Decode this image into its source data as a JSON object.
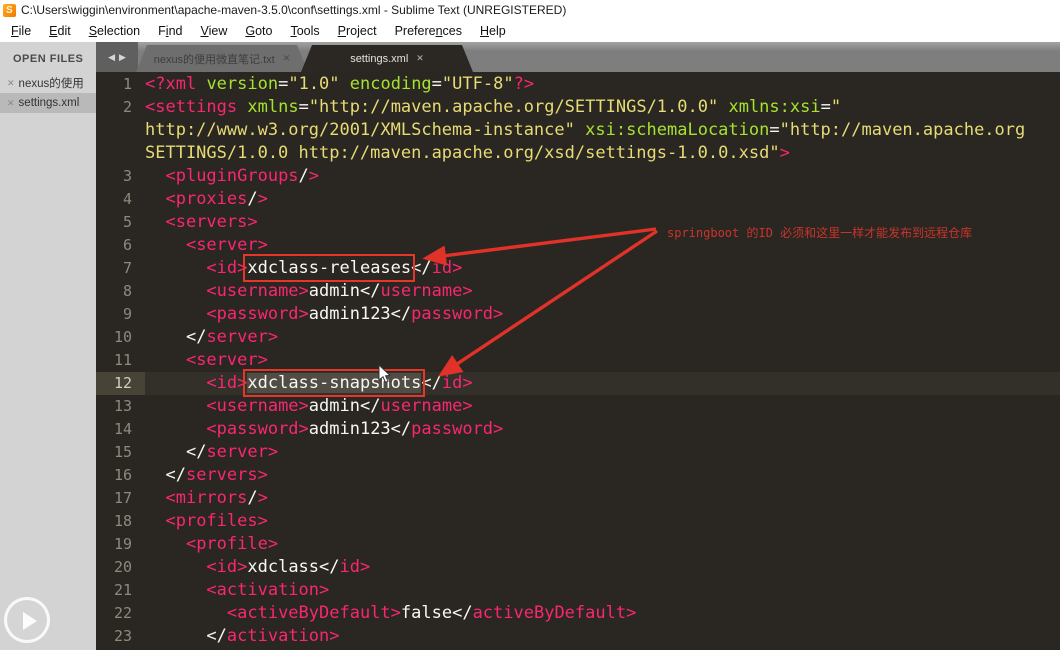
{
  "window": {
    "title": "C:\\Users\\wiggin\\environment\\apache-maven-3.5.0\\conf\\settings.xml - Sublime Text (UNREGISTERED)"
  },
  "menu": {
    "items": [
      {
        "label": "File",
        "u": 0
      },
      {
        "label": "Edit",
        "u": 0
      },
      {
        "label": "Selection",
        "u": 0
      },
      {
        "label": "Find",
        "u": 1
      },
      {
        "label": "View",
        "u": 0
      },
      {
        "label": "Goto",
        "u": 0
      },
      {
        "label": "Tools",
        "u": 0
      },
      {
        "label": "Project",
        "u": 0
      },
      {
        "label": "Preferences",
        "u": 7
      },
      {
        "label": "Help",
        "u": 0
      }
    ]
  },
  "sidebar": {
    "header": "OPEN FILES",
    "files": [
      {
        "label": "nexus的使用",
        "close": "✕",
        "selected": false
      },
      {
        "label": "settings.xml",
        "close": "✕",
        "selected": true
      }
    ]
  },
  "tabbar": {
    "prev_icon": "◀",
    "next_icon": "▶",
    "tabs": [
      {
        "label": "nexus的便用微直笔记.txt",
        "close": "✕",
        "active": false
      },
      {
        "label": "settings.xml",
        "close": "✕",
        "active": true
      }
    ]
  },
  "annotation": {
    "note": "springboot 的ID 必须和这里一样才能发布到远程仓库",
    "boxed_values": [
      "xdclass-releases",
      "xdclass-snapshots"
    ]
  },
  "colors": {
    "annotation_red": "#e8352a",
    "tag_pink": "#f92672",
    "attr_green": "#a6e22e",
    "string_yellow": "#e6db74",
    "editor_bg": "#2a2722",
    "sidebar_bg": "#d3d3d3"
  },
  "editor": {
    "current_line": "12",
    "rows": [
      {
        "n": "1",
        "toks": [
          [
            "t",
            "<?xml"
          ],
          [
            "x",
            " "
          ],
          [
            "a",
            "version"
          ],
          [
            "p",
            "="
          ],
          [
            "s",
            "\"1.0\""
          ],
          [
            "x",
            " "
          ],
          [
            "a",
            "encoding"
          ],
          [
            "p",
            "="
          ],
          [
            "s",
            "\"UTF-8\""
          ],
          [
            "t",
            "?>"
          ]
        ]
      },
      {
        "n": "2",
        "toks": [
          [
            "t",
            "<settings"
          ],
          [
            "x",
            " "
          ],
          [
            "a",
            "xmlns"
          ],
          [
            "p",
            "="
          ],
          [
            "s",
            "\"http://maven.apache.org/SETTINGS/1.0.0\""
          ],
          [
            "x",
            " "
          ],
          [
            "a",
            "xmlns:xsi"
          ],
          [
            "p",
            "="
          ],
          [
            "s",
            "\""
          ]
        ]
      },
      {
        "n": "",
        "toks": [
          [
            "s",
            "http://www.w3.org/2001/XMLSchema-instance\""
          ],
          [
            "x",
            " "
          ],
          [
            "a",
            "xsi:schemaLocation"
          ],
          [
            "p",
            "="
          ],
          [
            "s",
            "\"http://maven.apache.org"
          ]
        ]
      },
      {
        "n": "",
        "toks": [
          [
            "s",
            "SETTINGS/1.0.0 http://maven.apache.org/xsd/settings-1.0.0.xsd\""
          ],
          [
            "t",
            ">"
          ]
        ]
      },
      {
        "n": "3",
        "toks": [
          [
            "x",
            "  "
          ],
          [
            "t",
            "<pluginGroups"
          ],
          [
            "p",
            "/"
          ],
          [
            "t",
            ">"
          ]
        ]
      },
      {
        "n": "4",
        "toks": [
          [
            "x",
            "  "
          ],
          [
            "t",
            "<proxies"
          ],
          [
            "p",
            "/"
          ],
          [
            "t",
            ">"
          ]
        ]
      },
      {
        "n": "5",
        "toks": [
          [
            "x",
            "  "
          ],
          [
            "t",
            "<servers>"
          ]
        ]
      },
      {
        "n": "6",
        "toks": [
          [
            "x",
            "    "
          ],
          [
            "t",
            "<server>"
          ]
        ]
      },
      {
        "n": "7",
        "toks": [
          [
            "x",
            "      "
          ],
          [
            "t",
            "<id>"
          ],
          [
            "b",
            "xdclass-releases"
          ],
          [
            "p",
            "</"
          ],
          [
            "t",
            "id>"
          ]
        ]
      },
      {
        "n": "8",
        "toks": [
          [
            "x",
            "      "
          ],
          [
            "t",
            "<username>"
          ],
          [
            "x",
            "admin"
          ],
          [
            "p",
            "</"
          ],
          [
            "t",
            "username>"
          ]
        ]
      },
      {
        "n": "9",
        "toks": [
          [
            "x",
            "      "
          ],
          [
            "t",
            "<password>"
          ],
          [
            "x",
            "admin123"
          ],
          [
            "p",
            "</"
          ],
          [
            "t",
            "password>"
          ]
        ]
      },
      {
        "n": "10",
        "toks": [
          [
            "x",
            "    "
          ],
          [
            "p",
            "</"
          ],
          [
            "t",
            "server>"
          ]
        ]
      },
      {
        "n": "11",
        "toks": [
          [
            "x",
            "    "
          ],
          [
            "t",
            "<server>"
          ]
        ]
      },
      {
        "n": "12",
        "cur": true,
        "toks": [
          [
            "x",
            "      "
          ],
          [
            "t",
            "<id>"
          ],
          [
            "B",
            "xdclass-snapshots"
          ],
          [
            "p",
            "</"
          ],
          [
            "t",
            "id>"
          ]
        ]
      },
      {
        "n": "13",
        "toks": [
          [
            "x",
            "      "
          ],
          [
            "t",
            "<username>"
          ],
          [
            "x",
            "admin"
          ],
          [
            "p",
            "</"
          ],
          [
            "t",
            "username>"
          ]
        ]
      },
      {
        "n": "14",
        "toks": [
          [
            "x",
            "      "
          ],
          [
            "t",
            "<password>"
          ],
          [
            "x",
            "admin123"
          ],
          [
            "p",
            "</"
          ],
          [
            "t",
            "password>"
          ]
        ]
      },
      {
        "n": "15",
        "toks": [
          [
            "x",
            "    "
          ],
          [
            "p",
            "</"
          ],
          [
            "t",
            "server>"
          ]
        ]
      },
      {
        "n": "16",
        "toks": [
          [
            "x",
            "  "
          ],
          [
            "p",
            "</"
          ],
          [
            "t",
            "servers>"
          ]
        ]
      },
      {
        "n": "17",
        "toks": [
          [
            "x",
            "  "
          ],
          [
            "t",
            "<mirrors"
          ],
          [
            "p",
            "/"
          ],
          [
            "t",
            ">"
          ]
        ]
      },
      {
        "n": "18",
        "toks": [
          [
            "x",
            "  "
          ],
          [
            "t",
            "<profiles>"
          ]
        ]
      },
      {
        "n": "19",
        "toks": [
          [
            "x",
            "    "
          ],
          [
            "t",
            "<profile>"
          ]
        ]
      },
      {
        "n": "20",
        "toks": [
          [
            "x",
            "      "
          ],
          [
            "t",
            "<id>"
          ],
          [
            "x",
            "xdclass"
          ],
          [
            "p",
            "</"
          ],
          [
            "t",
            "id>"
          ]
        ]
      },
      {
        "n": "21",
        "toks": [
          [
            "x",
            "      "
          ],
          [
            "t",
            "<activation>"
          ]
        ]
      },
      {
        "n": "22",
        "toks": [
          [
            "x",
            "        "
          ],
          [
            "t",
            "<activeByDefault>"
          ],
          [
            "x",
            "false"
          ],
          [
            "p",
            "</"
          ],
          [
            "t",
            "activeByDefault>"
          ]
        ]
      },
      {
        "n": "23",
        "toks": [
          [
            "x",
            "      "
          ],
          [
            "p",
            "</"
          ],
          [
            "t",
            "activation>"
          ]
        ]
      }
    ]
  }
}
